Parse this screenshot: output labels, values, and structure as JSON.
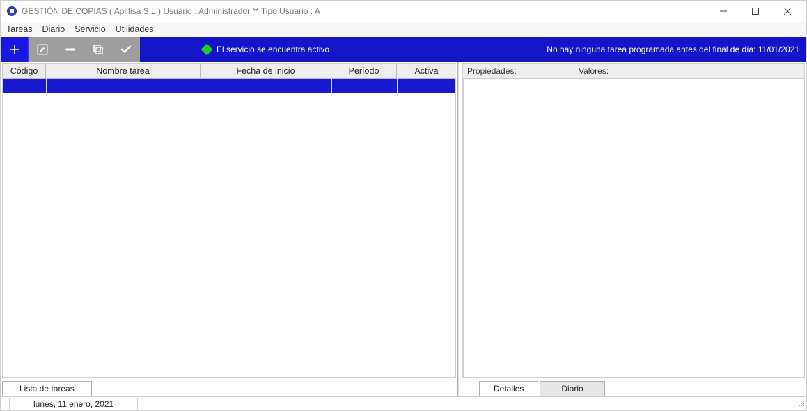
{
  "titlebar": {
    "title": "GESTIÓN DE COPIAS  ( Aplifisa S.L.)   Usuario : Administrador  **  Tipo Usuario : A"
  },
  "menu": {
    "tareas": "Tareas",
    "diario": "Diario",
    "servicio": "Servicio",
    "utilidades": "Utilidades"
  },
  "toolbar": {
    "status_active": "El servicio se encuentra activo",
    "status_right": "No hay ninguna tarea programada antes del final de día: 11/01/2021"
  },
  "left_grid": {
    "headers": {
      "codigo": "Código",
      "nombre": "Nombre tarea",
      "fecha": "Fecha de inicio",
      "periodo": "Período",
      "activa": "Activa"
    },
    "tab": "Lista de tareas"
  },
  "right_grid": {
    "headers": {
      "prop": "Propiedades:",
      "val": "Valores:"
    },
    "tabs": {
      "detalles": "Detalles",
      "diario": "Diario"
    }
  },
  "statusbar": {
    "date": "lunes, 11 enero, 2021"
  }
}
